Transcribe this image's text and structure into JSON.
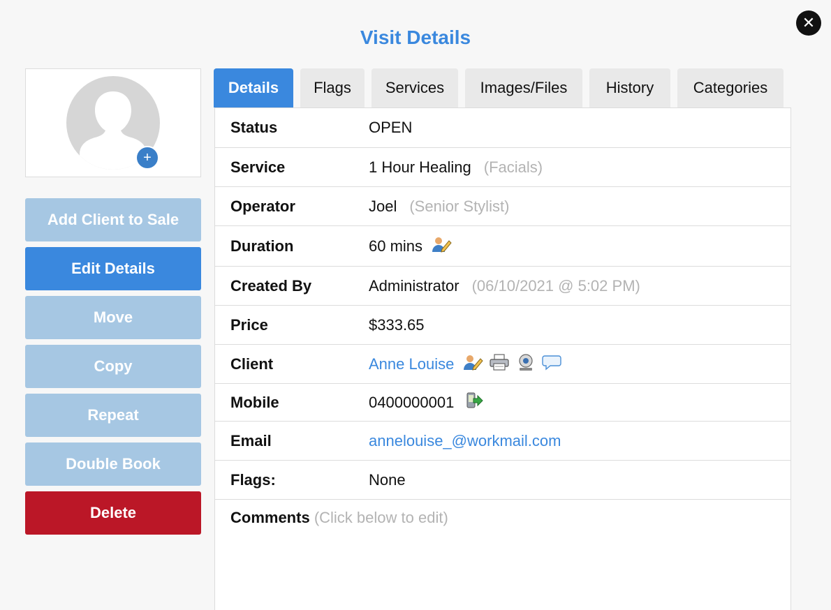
{
  "title": "Visit Details",
  "close_label": "✕",
  "avatar": {
    "add_label": "+"
  },
  "actions": [
    {
      "label": "Add Client to Sale"
    },
    {
      "label": "Edit Details"
    },
    {
      "label": "Move"
    },
    {
      "label": "Copy"
    },
    {
      "label": "Repeat"
    },
    {
      "label": "Double Book"
    },
    {
      "label": "Delete"
    }
  ],
  "tabs": [
    {
      "label": "Details",
      "active": true
    },
    {
      "label": "Flags"
    },
    {
      "label": "Services"
    },
    {
      "label": "Images/Files"
    },
    {
      "label": "History"
    },
    {
      "label": "Categories"
    }
  ],
  "details": {
    "status": {
      "label": "Status",
      "value": "OPEN"
    },
    "service": {
      "label": "Service",
      "value": "1 Hour Healing",
      "note": "(Facials)"
    },
    "operator": {
      "label": "Operator",
      "value": "Joel",
      "note": "(Senior Stylist)"
    },
    "duration": {
      "label": "Duration",
      "value": "60 mins",
      "icon": "edit-person-icon"
    },
    "created_by": {
      "label": "Created By",
      "value": "Administrator",
      "note": "(06/10/2021 @ 5:02 PM)"
    },
    "price": {
      "label": "Price",
      "value": "$333.65"
    },
    "client": {
      "label": "Client",
      "value": "Anne Louise",
      "icons": [
        "edit-person-icon",
        "print-icon",
        "webcam-icon",
        "chat-icon"
      ]
    },
    "mobile": {
      "label": "Mobile",
      "value": "0400000001",
      "icon": "send-sms-icon"
    },
    "email": {
      "label": "Email",
      "value": "annelouise_@workmail.com"
    },
    "flags": {
      "label": "Flags:",
      "value": "None"
    },
    "comments": {
      "label": "Comments",
      "hint": "(Click below to edit)"
    }
  },
  "colors": {
    "accent": "#3a88de",
    "button_light": "#a6c7e3",
    "danger": "#bb1727",
    "muted_text": "#b3b3b3"
  }
}
